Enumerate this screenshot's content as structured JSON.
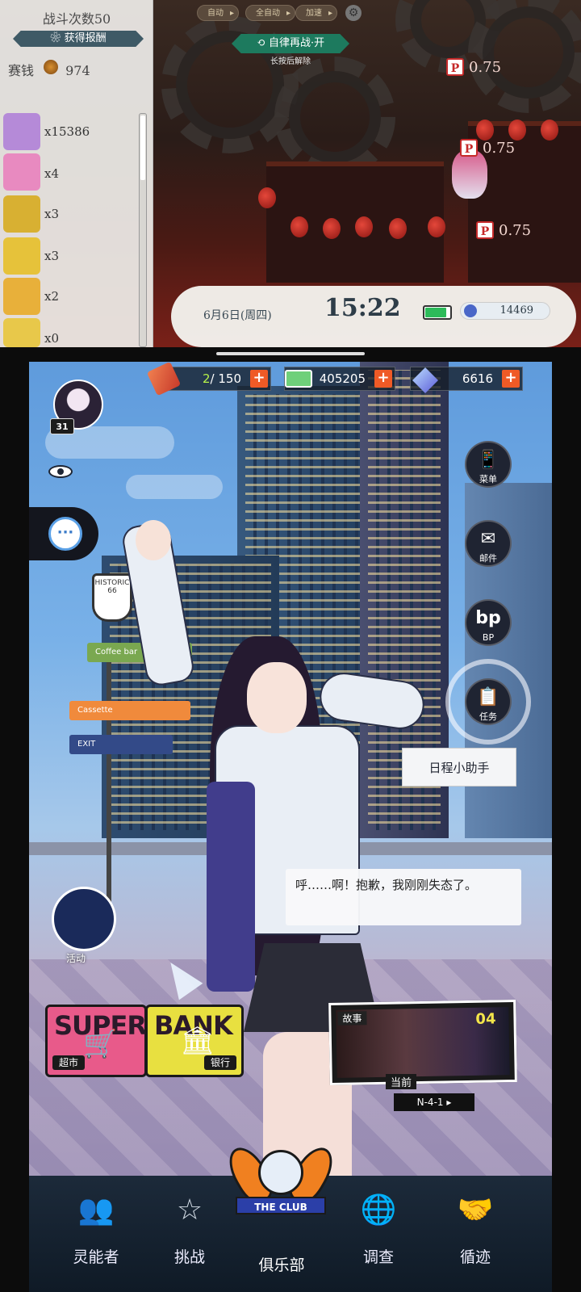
{
  "top": {
    "battle_count": "战斗次数50",
    "reward_header": "获得报酬",
    "money_label": "赛钱",
    "money_value": "974",
    "items": [
      {
        "icon": "purple-token-icon",
        "count": "x15386",
        "color": "#b58ad8"
      },
      {
        "icon": "cake-icon",
        "count": "x4",
        "color": "#e88ac0"
      },
      {
        "icon": "green-book-icon",
        "count": "x3",
        "color": "#d8b032"
      },
      {
        "icon": "yellow-book-icon",
        "count": "x3",
        "color": "#e6c23a"
      },
      {
        "icon": "mahjong-tile-icon",
        "count": "x2",
        "color": "#e8b03a"
      },
      {
        "icon": "mahjong-tile-2-icon",
        "count": "x0",
        "color": "#e8c84a"
      }
    ],
    "buttons": {
      "auto": "自动",
      "full_auto": "全自动",
      "speed": "加速"
    },
    "auto_retry": "自律再战·开",
    "auto_retry_hint": "长按后解除",
    "p_markers": [
      "0.75",
      "0.75",
      "0.75"
    ],
    "status": {
      "date": "6月6日(周四)",
      "time": "15:22",
      "energy": "14469",
      "battery_level": 0.85
    }
  },
  "bottom": {
    "resources": [
      {
        "icon": "ticket-icon",
        "current": "2",
        "max": "/ 150"
      },
      {
        "icon": "cash-icon",
        "value": "405205"
      },
      {
        "icon": "crystal-icon",
        "value": "6616"
      }
    ],
    "player_level": "31",
    "side_buttons": [
      {
        "icon": "phone-icon",
        "label": "菜单"
      },
      {
        "icon": "mail-icon",
        "label": "邮件"
      },
      {
        "icon": "bp-icon",
        "label": "BP"
      },
      {
        "icon": "clipboard-icon",
        "label": "任务"
      }
    ],
    "tooltip": "日程小助手",
    "dialogue": "呼……啊！抱歉，我刚刚失态了。",
    "event_label": "活动",
    "shop": {
      "big_text": "SUPER",
      "label": "超市"
    },
    "bank": {
      "big_text": "BANK",
      "label": "银行"
    },
    "story": {
      "label": "故事",
      "episode": "04",
      "current": "当前",
      "stage": "N-4-1  ▸"
    },
    "signs": {
      "s1": "Coffee bar",
      "s2": "Cassette",
      "s3": "EXIT",
      "s4": "HISTORIC 66"
    },
    "club_logo_text": "THE CLUB",
    "nav": [
      {
        "icon": "agents-icon",
        "label": "灵能者"
      },
      {
        "icon": "star-icon",
        "label": "挑战"
      },
      {
        "icon": "club-icon",
        "label": "俱乐部"
      },
      {
        "icon": "globe-icon",
        "label": "调查"
      },
      {
        "icon": "handshake-icon",
        "label": "循迹"
      }
    ]
  }
}
